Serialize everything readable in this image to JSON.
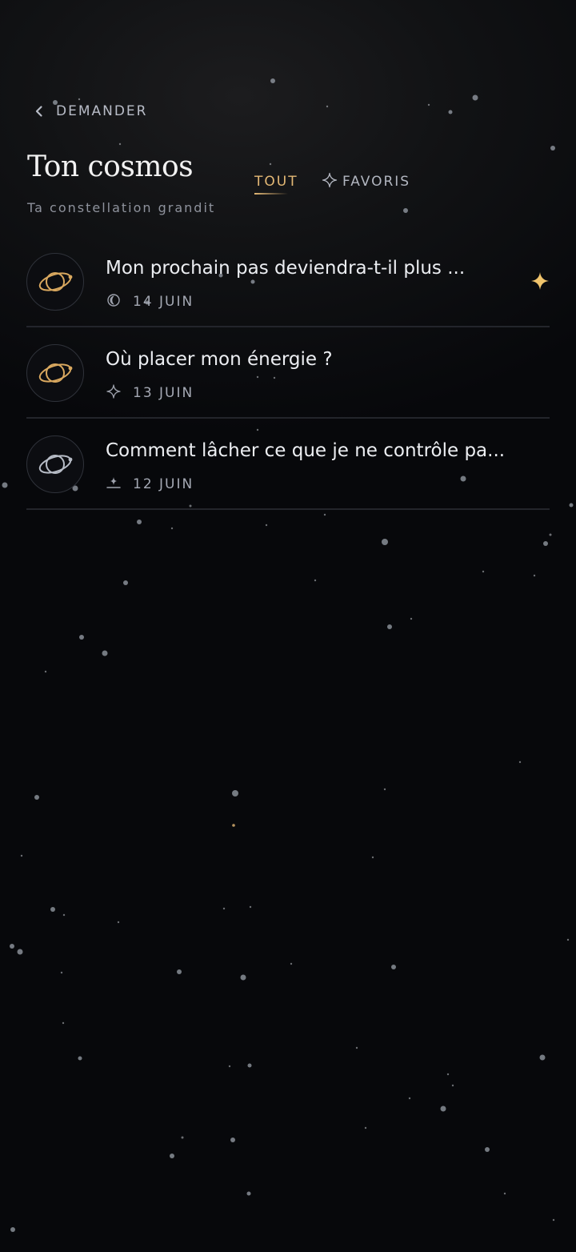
{
  "nav": {
    "back_label": "DEMANDER"
  },
  "header": {
    "title": "Ton cosmos",
    "subtitle": "Ta constellation grandit"
  },
  "tabs": [
    {
      "label": "TOUT",
      "active": true
    },
    {
      "label": "FAVORIS",
      "active": false,
      "icon": "star-outline-icon"
    }
  ],
  "colors": {
    "background": "#07080b",
    "accent_gold": "#e3b875",
    "text": "#eceef2",
    "muted": "#a5a9b4",
    "divider": "#23252b"
  },
  "entries": [
    {
      "question": "Mon prochain pas deviendra-t-il plus ...",
      "date": "14 JUIN",
      "meta_icon": "moon-icon",
      "planet_color": "gold",
      "favorite": true
    },
    {
      "question": "Où placer mon énergie ?",
      "date": "13 JUIN",
      "meta_icon": "sparkle-icon",
      "planet_color": "gold",
      "favorite": false
    },
    {
      "question": "Comment lâcher ce que je ne contrôle pa...",
      "date": "12 JUIN",
      "meta_icon": "horizon-icon",
      "planet_color": "silver",
      "favorite": false
    }
  ]
}
